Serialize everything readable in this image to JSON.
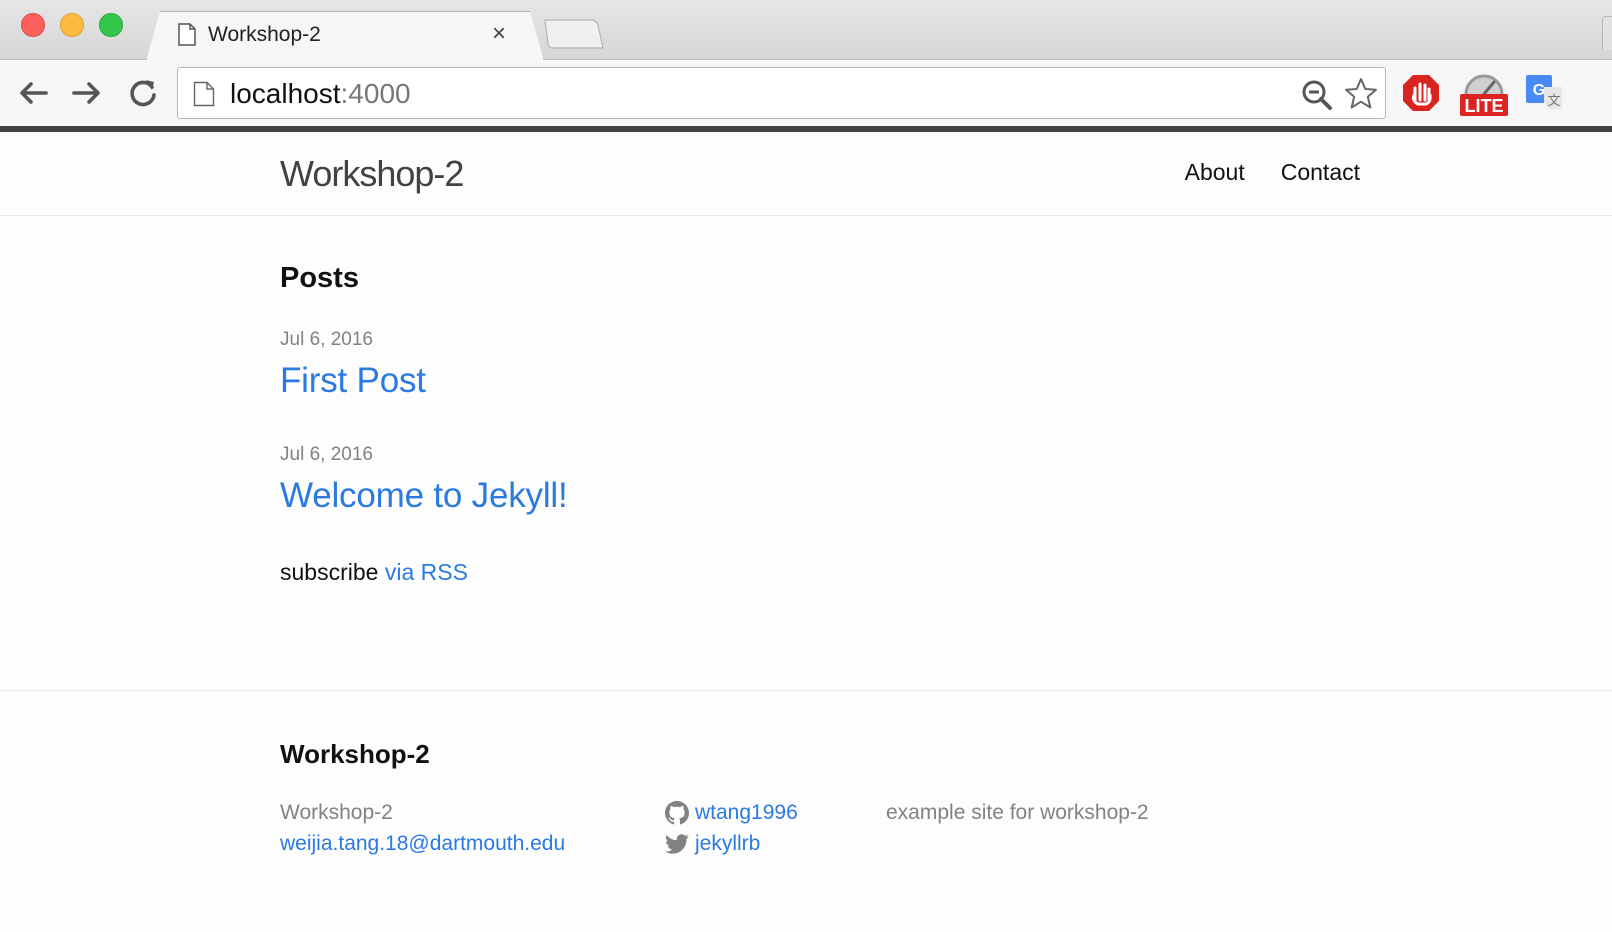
{
  "browser": {
    "tab_title": "Workshop-2",
    "tab_close": "×",
    "url_host": "localhost",
    "url_port": ":4000",
    "extensions": [
      "stop-adblock-icon",
      "lite-speedometer-icon",
      "google-translate-icon"
    ]
  },
  "header": {
    "site_title": "Workshop-2",
    "nav": [
      {
        "label": "About"
      },
      {
        "label": "Contact"
      }
    ]
  },
  "main": {
    "heading": "Posts",
    "posts": [
      {
        "date": "Jul 6, 2016",
        "title": "First Post"
      },
      {
        "date": "Jul 6, 2016",
        "title": "Welcome to Jekyll!"
      }
    ],
    "subscribe_prefix": "subscribe",
    "subscribe_link": "via RSS"
  },
  "footer": {
    "heading": "Workshop-2",
    "name": "Workshop-2",
    "email": "weijia.tang.18@dartmouth.edu",
    "github": "wtang1996",
    "twitter": "jekyllrb",
    "description": "example site for workshop-2"
  },
  "colors": {
    "link": "#2a7ae2",
    "muted": "#828282",
    "text": "#111111"
  }
}
